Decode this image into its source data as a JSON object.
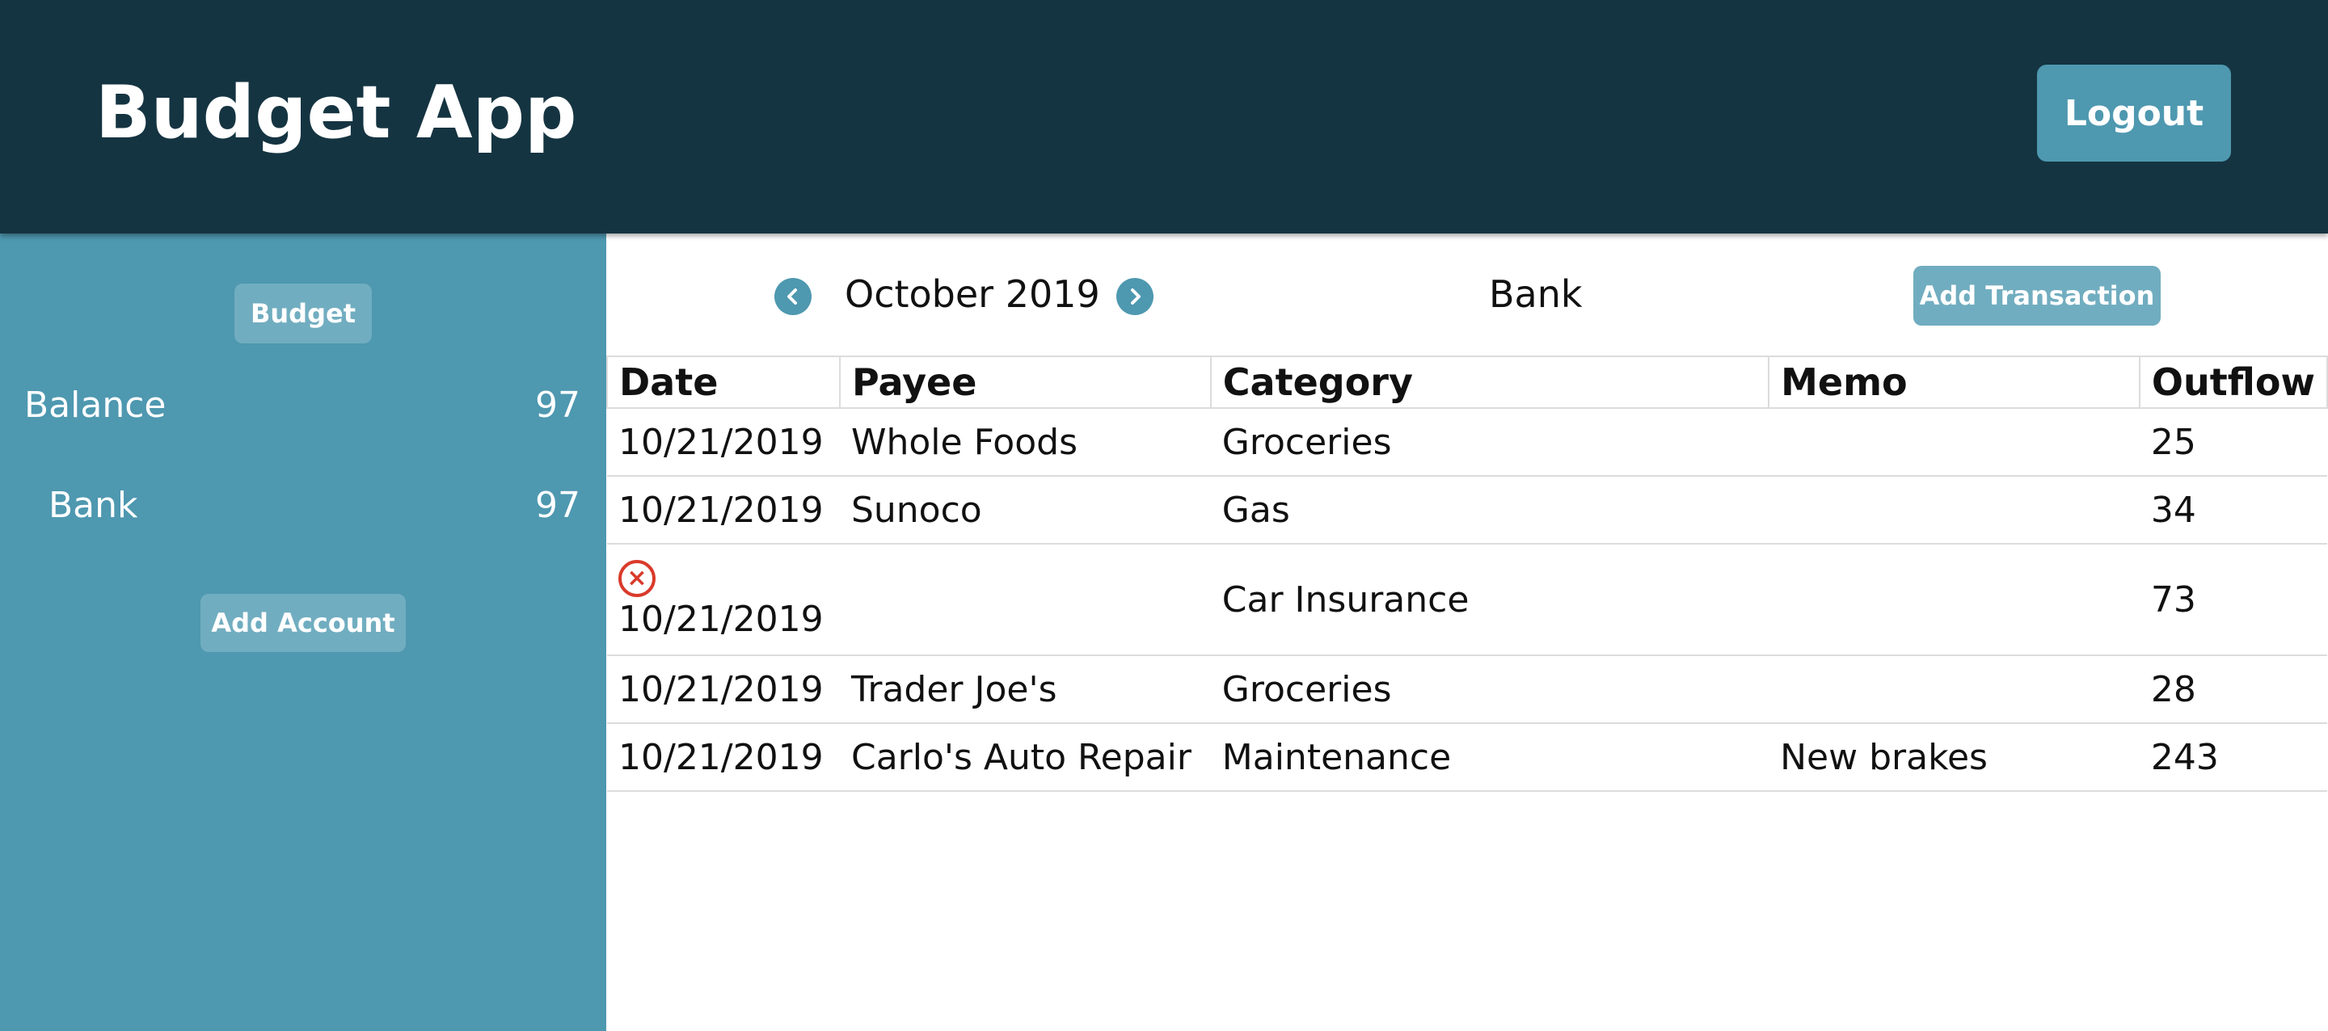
{
  "header": {
    "title": "Budget App",
    "logout_label": "Logout"
  },
  "sidebar": {
    "budget_label": "Budget",
    "balance": {
      "label": "Balance",
      "value": "97"
    },
    "accounts": [
      {
        "label": "Bank",
        "value": "97"
      }
    ],
    "add_account_label": "Add Account"
  },
  "toolbar": {
    "month": "October 2019",
    "account": "Bank",
    "add_transaction_label": "Add Transaction",
    "prev_icon": "chevron-left-icon",
    "next_icon": "chevron-right-icon"
  },
  "table": {
    "columns": [
      "Date",
      "Payee",
      "Category",
      "Memo",
      "Outflow"
    ],
    "rows": [
      {
        "date": "10/21/2019",
        "payee": "Whole Foods",
        "category": "Groceries",
        "memo": "",
        "outflow": "25"
      },
      {
        "date": "10/21/2019",
        "payee": "Sunoco",
        "category": "Gas",
        "memo": "",
        "outflow": "34"
      },
      {
        "date": "10/21/2019",
        "payee": "",
        "category": "Car Insurance",
        "memo": "",
        "outflow": "73",
        "delete_icon": "close-circle-icon"
      },
      {
        "date": "10/21/2019",
        "payee": "Trader Joe's",
        "category": "Groceries",
        "memo": "",
        "outflow": "28"
      },
      {
        "date": "10/21/2019",
        "payee": "Carlo's Auto Repair",
        "category": "Maintenance",
        "memo": "New brakes",
        "outflow": "243"
      }
    ]
  },
  "colors": {
    "header_bg": "#153441",
    "sidebar_bg": "#4e98b0",
    "button_bg": "#4e98b0",
    "pill_bg": "#71adc0",
    "delete_red": "#d93a2b"
  }
}
